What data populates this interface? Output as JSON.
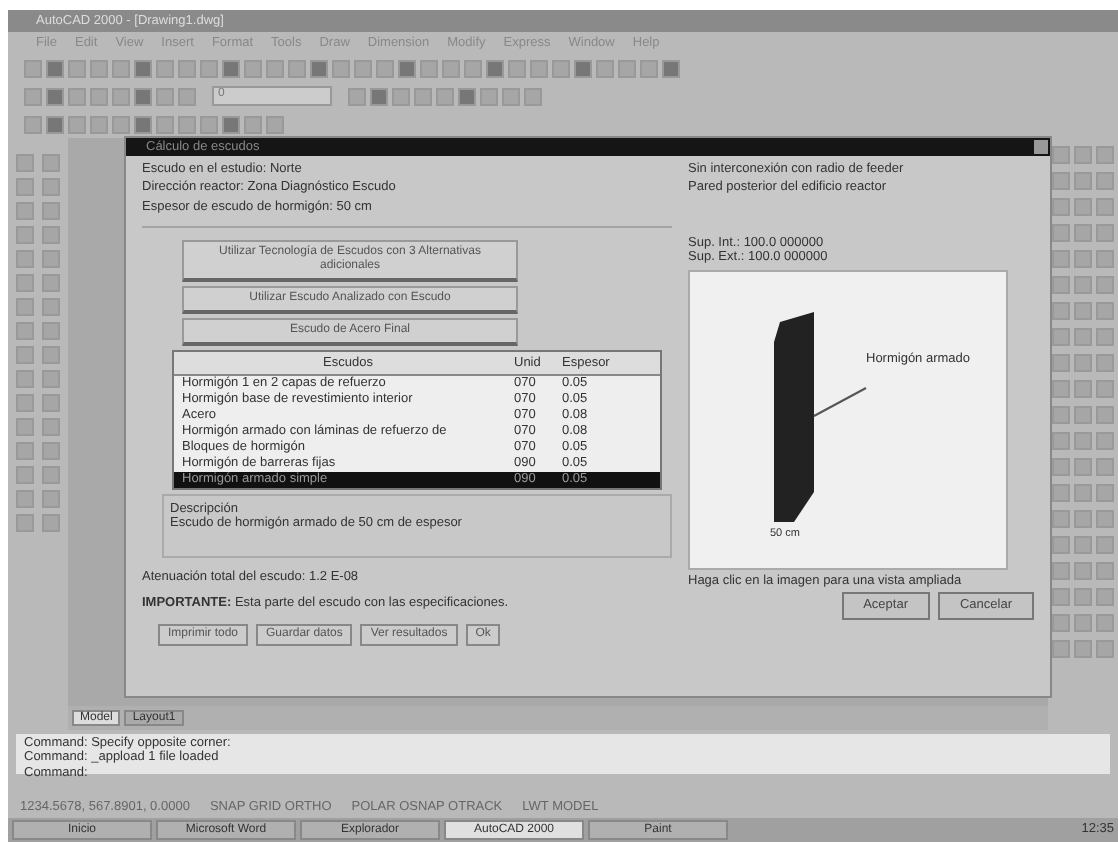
{
  "window": {
    "title": "AutoCAD 2000 - [Drawing1.dwg]"
  },
  "menu": [
    "File",
    "Edit",
    "View",
    "Insert",
    "Format",
    "Tools",
    "Draw",
    "Dimension",
    "Modify",
    "Express",
    "Window",
    "Help"
  ],
  "layer_field": {
    "value": "0"
  },
  "dialog": {
    "title": "Cálculo de escudos",
    "info_left": [
      "Escudo en el estudio:  Norte",
      "Dirección reactor:    Zona Diagnóstico Escudo",
      "Espesor de escudo de hormigón:  50  cm"
    ],
    "info_right": [
      "Sin interconexión con radio de feeder",
      "Pared posterior del edificio reactor"
    ],
    "option_buttons": [
      "Utilizar Tecnología de Escudos con 3 Alternativas adicionales",
      "Utilizar Escudo Analizado con Escudo",
      "Escudo de Acero Final"
    ],
    "list": {
      "columns": [
        "Escudos",
        "Unid",
        "Espesor"
      ],
      "rows": [
        {
          "cells": [
            "Hormigón 1 en 2 capas de refuerzo",
            "070",
            "0.05"
          ],
          "selected": false
        },
        {
          "cells": [
            "Hormigón base de revestimiento interior",
            "070",
            "0.05"
          ],
          "selected": false
        },
        {
          "cells": [
            "Acero",
            "070",
            "0.08"
          ],
          "selected": false
        },
        {
          "cells": [
            "Hormigón armado con láminas de refuerzo de",
            "070",
            "0.08"
          ],
          "selected": false
        },
        {
          "cells": [
            "Bloques de hormigón",
            "070",
            "0.05"
          ],
          "selected": false
        },
        {
          "cells": [
            "Hormigón de barreras fijas",
            "090",
            "0.05"
          ],
          "selected": false
        },
        {
          "cells": [
            "Hormigón armado simple",
            "090",
            "0.05"
          ],
          "selected": true
        }
      ]
    },
    "description_label": "Descripción",
    "description": "Escudo de hormigón armado de 50 cm de espesor",
    "attenuation": "Atenuación total del escudo:  1.2 E-08",
    "note": "**IMPORTANTE:** Esta parte del escudo con las especificaciones.",
    "bottom_buttons": [
      "Imprimir todo",
      "Guardar datos",
      "Ver resultados",
      "Ok"
    ],
    "surfaces": [
      "Sup. Int.:   100.0  000000",
      "Sup. Ext.:   100.0  000000"
    ],
    "preview_label": "Hormigón armado",
    "preview_dimension": "50 cm",
    "preview_caption": "Haga clic en la imagen para una vista ampliada",
    "actions": [
      "Aceptar",
      "Cancelar"
    ]
  },
  "layout_tabs": [
    {
      "label": "Model",
      "selected": true
    },
    {
      "label": "Layout1",
      "selected": false
    }
  ],
  "command_lines": [
    "Command:  Specify opposite corner:",
    "Command:  _appload  1 file loaded",
    "Command:"
  ],
  "status_bar": "1234.5678, 567.8901, 0.0000",
  "status_toggles": [
    "SNAP GRID ORTHO",
    "POLAR OSNAP OTRACK",
    "LWT MODEL"
  ],
  "taskbar": [
    {
      "label": "Inicio",
      "selected": false
    },
    {
      "label": "Microsoft Word",
      "selected": false
    },
    {
      "label": "Explorador",
      "selected": false
    },
    {
      "label": "AutoCAD 2000",
      "selected": true
    },
    {
      "label": "Paint",
      "selected": false
    }
  ],
  "clock": "12:35"
}
